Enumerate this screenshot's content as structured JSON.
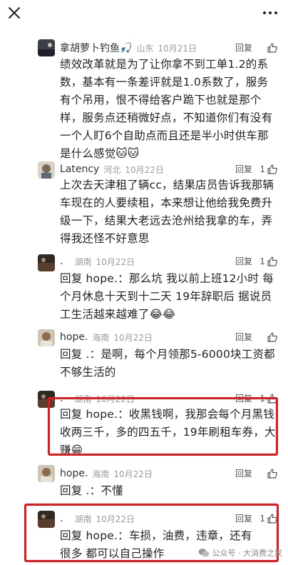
{
  "header": {
    "close_icon": "close-icon",
    "more_icon": "more-icon"
  },
  "comments": [
    {
      "username": "拿胡萝卜钓鱼🎣",
      "region": "山东",
      "date": "10月21日",
      "reply": "回复",
      "likes": "",
      "text": "绩效改革就是为了让你拿不到工单1.2的系数，基本有一条差评就是1.0系数了，服务有个吊用，恨不得给客户跪下也就是那个样，服务点还稍微好点，不知道你们有没有一个人盯6个自助点而且还是半小时供车那是什么感觉🐱🐱"
    },
    {
      "username": "Latency",
      "region": "河北",
      "date": "10月22日",
      "reply": "回复",
      "likes": "1",
      "text": "上次去天津租了辆cc，结果店员告诉我那辆车现在的人要续租，本来想让他给我免费升级一下，结果大老远去沧州给我拿的车，弄得我还怪不好意思"
    },
    {
      "username": ".",
      "region": "湖南",
      "date": "10月22日",
      "reply": "回复",
      "likes": "1",
      "text": "回复 hope.：那么坑  我以前上班12小时  每个月休息十天到十二天  19年辞职后 据说员工生活越来越难了😂😂"
    },
    {
      "username": "hope.",
      "region": "海南",
      "date": "10月22日",
      "reply": "回复",
      "likes": "",
      "text": "回复 .：是啊，每个月领那5-6000块工资都不够生活的"
    },
    {
      "username": ".",
      "region": "湖南",
      "date": "10月22日",
      "reply": "回复",
      "likes": "1",
      "text": "回复 hope.：收黑钱啊，我那会每个月黑钱收两三千，多的四五千，19年刷租车券，大赚😁"
    },
    {
      "username": "hope.",
      "region": "海南",
      "date": "10月22日",
      "reply": "回复",
      "likes": "",
      "text": "回复 .：不懂"
    },
    {
      "username": ".",
      "region": "湖南",
      "date": "10月22日",
      "reply": "回复",
      "likes": "1",
      "text": "回复 hope.：车损，油费，违章，还有很多   都可以自己操作"
    }
  ],
  "watermark": {
    "text": "公众号 · 大消费之家"
  },
  "colors": {
    "highlight": "#e8181a",
    "meta_gray": "#9a9a9a"
  }
}
